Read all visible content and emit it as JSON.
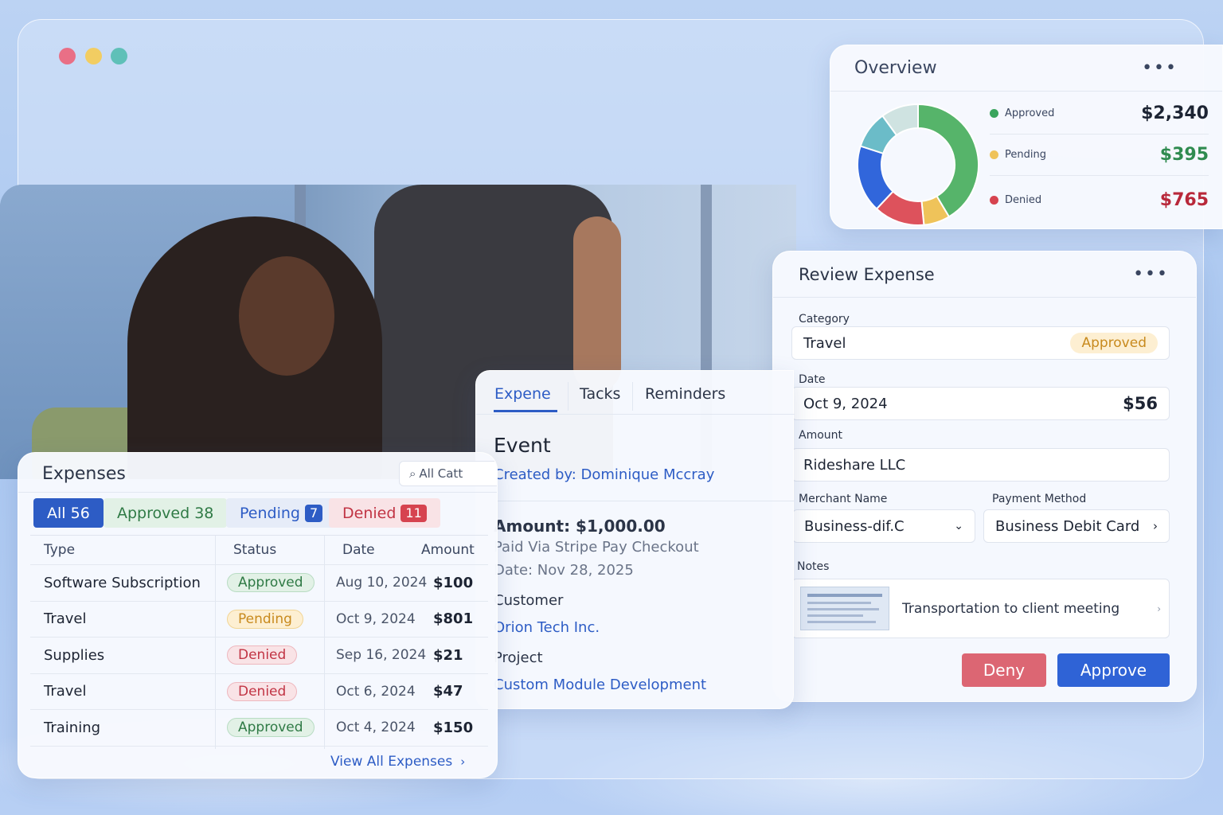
{
  "overview": {
    "title": "Overview",
    "more": "•••",
    "legend": [
      {
        "label": "Approved",
        "value": "$2,340",
        "color": "#3aa55c"
      },
      {
        "label": "Pending",
        "value": "$395",
        "color": "#efc35a"
      },
      {
        "label": "Denied",
        "value": "$765",
        "color": "#d6434f"
      }
    ]
  },
  "review": {
    "title": "Review Expense",
    "more": "•••",
    "category_label": "Category",
    "category_value": "Travel",
    "category_status": "Approved",
    "date_label": "Date",
    "date_value": "Oct 9, 2024",
    "date_amount": "$56",
    "amount_label": "Amount",
    "amount_value": "Rideshare LLC",
    "merchant_label": "Merchant Name",
    "merchant_value": "Business-dif.C",
    "payment_label": "Payment Method",
    "payment_value": "Business Debit Card",
    "notes_label": "Notes",
    "notes_value": "Transportation to client meeting",
    "deny": "Deny",
    "approve": "Approve"
  },
  "task": {
    "tabs": [
      "Expene",
      "Tacks",
      "Reminders"
    ],
    "event_title": "Event",
    "created_by": "Created by: Dominique Mccray",
    "amount": "Amount: $1,000.00",
    "paid_via": "Paid Via Stripe Pay Checkout",
    "date": "Date: Nov 28, 2025",
    "customer_label": "Customer",
    "customer_value": "Orion Tech Inc.",
    "project_label": "Project",
    "project_value": "Custom Module Development"
  },
  "expenses": {
    "title": "Expenses",
    "search_placeholder": "All Catt",
    "filters": [
      {
        "label": "All",
        "count": "56"
      },
      {
        "label": "Approved",
        "count": "38"
      },
      {
        "label": "Pending",
        "count": "7"
      },
      {
        "label": "Denied",
        "count": "11"
      }
    ],
    "columns": [
      "Type",
      "Status",
      "Date",
      "Amount"
    ],
    "rows": [
      {
        "type": "Software Subscription",
        "status": "Approved",
        "date": "Aug 10, 2024",
        "amount": "$100"
      },
      {
        "type": "Travel",
        "status": "Pending",
        "date": "Oct 9, 2024",
        "amount": "$801"
      },
      {
        "type": "Supplies",
        "status": "Denied",
        "date": "Sep 16, 2024",
        "amount": "$21"
      },
      {
        "type": "Travel",
        "status": "Denied",
        "date": "Oct 6, 2024",
        "amount": "$47"
      },
      {
        "type": "Training",
        "status": "Approved",
        "date": "Oct 4, 2024",
        "amount": "$150"
      }
    ],
    "view_all": "View All Expenses"
  },
  "chart_data": {
    "type": "pie",
    "categories": [
      "Approved",
      "Pending",
      "Denied"
    ],
    "values": [
      2340,
      395,
      765
    ],
    "colors": [
      "#56b46a",
      "#efc35a",
      "#dd525c"
    ],
    "extra_segments_colors": [
      "#3166db",
      "#6bbcc8",
      "#cfe3e1"
    ]
  }
}
